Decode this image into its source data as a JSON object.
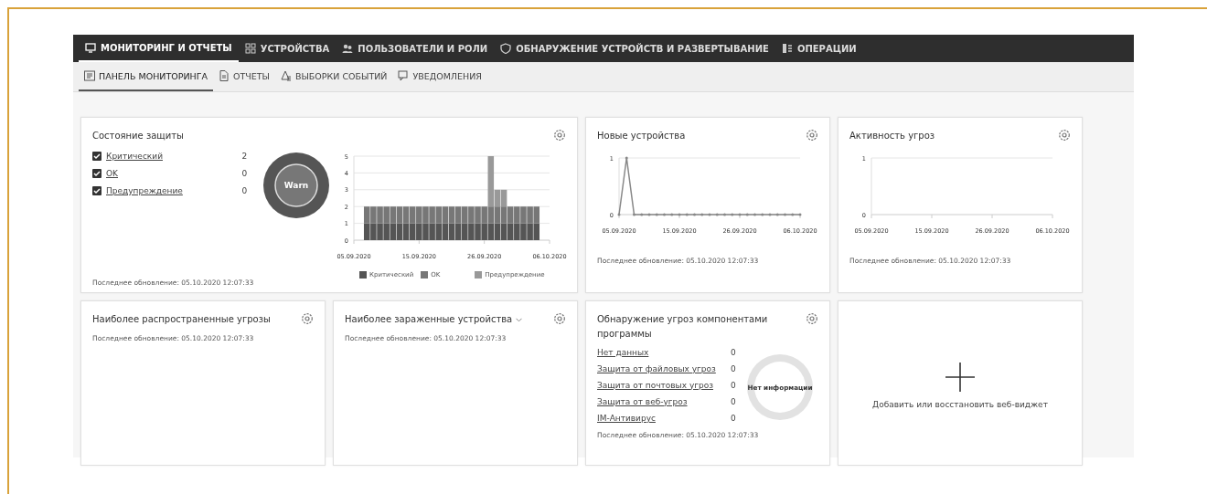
{
  "nav": [
    {
      "label": "МОНИТОРИНГ И ОТЧЕТЫ",
      "selected": true
    },
    {
      "label": "УСТРОЙСТВА",
      "selected": false
    },
    {
      "label": "ПОЛЬЗОВАТЕЛИ И РОЛИ",
      "selected": false
    },
    {
      "label": "ОБНАРУЖЕНИЕ УСТРОЙСТВ И РАЗВЕРТЫВАНИЕ",
      "selected": false
    },
    {
      "label": "ОПЕРАЦИИ",
      "selected": false
    }
  ],
  "subnav": [
    {
      "label": "ПАНЕЛЬ МОНИТОРИНГА",
      "selected": true
    },
    {
      "label": "ОТЧЕТЫ",
      "selected": false
    },
    {
      "label": "ВЫБОРКИ СОБЫТИЙ",
      "selected": false
    },
    {
      "label": "УВЕДОМЛЕНИЯ",
      "selected": false
    }
  ],
  "widgets": [
    {
      "kind": "status",
      "title": "Состояние защиты",
      "updated": "Последнее обновление: 05.10.2020 12:07:33",
      "items": [
        {
          "label": "Критический",
          "count": "2",
          "checked": true
        },
        {
          "label": "OK",
          "count": "0",
          "checked": true
        },
        {
          "label": "Предупреждение",
          "count": "0",
          "checked": true
        }
      ],
      "donut": "Warn",
      "chart_data": {
        "type": "bar",
        "stacked": true,
        "grid": true,
        "ylim": [
          0,
          5
        ],
        "yticks": [
          0,
          1,
          2,
          3,
          4,
          5
        ],
        "categories": [
          "05.09.2020",
          null,
          null,
          null,
          null,
          null,
          null,
          null,
          null,
          null,
          "15.09.2020",
          null,
          null,
          null,
          null,
          null,
          null,
          null,
          null,
          null,
          "26.09.2020",
          null,
          null,
          null,
          null,
          null,
          null,
          null,
          null,
          null,
          "06.10.2020"
        ],
        "series": [
          {
            "name": "Критический",
            "color": "#555555",
            "values": [
              null,
              null,
              1,
              1,
              1,
              1,
              1,
              1,
              1,
              1,
              1,
              1,
              1,
              1,
              1,
              1,
              1,
              1,
              1,
              1,
              1,
              1,
              1,
              1,
              1,
              1,
              1,
              1,
              1,
              null,
              null
            ]
          },
          {
            "name": "OK",
            "color": "#777777",
            "values": [
              null,
              null,
              1,
              1,
              1,
              1,
              1,
              1,
              1,
              1,
              1,
              1,
              1,
              1,
              1,
              1,
              1,
              1,
              1,
              1,
              1,
              1,
              1,
              1,
              1,
              1,
              1,
              1,
              1,
              null,
              null
            ]
          },
          {
            "name": "Предупреждение",
            "color": "#999999",
            "values": [
              null,
              null,
              0,
              0,
              0,
              0,
              0,
              0,
              0,
              0,
              0,
              0,
              0,
              0,
              0,
              0,
              0,
              0,
              0,
              0,
              0,
              3,
              1,
              1,
              0,
              0,
              0,
              0,
              0,
              null,
              null
            ]
          }
        ]
      }
    },
    {
      "kind": "line",
      "title": "Новые устройства",
      "updated": "Последнее обновление: 05.10.2020 12:07:33",
      "chart_data": {
        "type": "line",
        "grid": true,
        "ylim": [
          0,
          1
        ],
        "yticks": [
          0,
          1
        ],
        "categories": [
          "05.09.2020",
          null,
          null,
          null,
          null,
          null,
          null,
          null,
          "15.09.2020",
          null,
          null,
          null,
          null,
          null,
          null,
          null,
          "26.09.2020",
          null,
          null,
          null,
          null,
          null,
          null,
          null,
          "06.10.2020"
        ],
        "series": [
          {
            "color": "#888888",
            "values": [
              0,
              1,
              0,
              0,
              0,
              0,
              0,
              0,
              0,
              0,
              0,
              0,
              0,
              0,
              0,
              0,
              0,
              0,
              0,
              0,
              0,
              0,
              0,
              0,
              0
            ]
          }
        ]
      }
    },
    {
      "kind": "line",
      "title": "Активность угроз",
      "updated": "Последнее обновление: 05.10.2020 12:07:33",
      "chart_data": {
        "type": "line",
        "grid": true,
        "ylim": [
          0,
          1
        ],
        "yticks": [
          0,
          1
        ],
        "categories": [
          "05.09.2020",
          null,
          null,
          null,
          null,
          null,
          null,
          null,
          "15.09.2020",
          null,
          null,
          null,
          null,
          null,
          null,
          null,
          "26.09.2020",
          null,
          null,
          null,
          null,
          null,
          null,
          null,
          "06.10.2020"
        ]
      }
    },
    {
      "kind": "empty",
      "title": "Наиболее распространенные угрозы",
      "updated": "Последнее обновление: 05.10.2020 12:07:33"
    },
    {
      "kind": "empty",
      "title": "Наиболее зараженные устройства",
      "dropdown": true,
      "updated": "Последнее обновление: 05.10.2020 12:07:33"
    },
    {
      "kind": "list",
      "title": "Обнаружение угроз компонентами программы",
      "updated": "Последнее обновление: 05.10.2020 12:07:33",
      "items": [
        {
          "label": "Нет данных",
          "count": "0"
        },
        {
          "label": "Защита от файловых угроз",
          "count": "0"
        },
        {
          "label": "Защита от почтовых угроз",
          "count": "0"
        },
        {
          "label": "Защита от веб-угроз",
          "count": "0"
        },
        {
          "label": "IM-Антивирус",
          "count": "0"
        }
      ],
      "donut": "Нет информации"
    },
    {
      "kind": "add",
      "label": "Добавить или восстановить веб-виджет"
    }
  ]
}
